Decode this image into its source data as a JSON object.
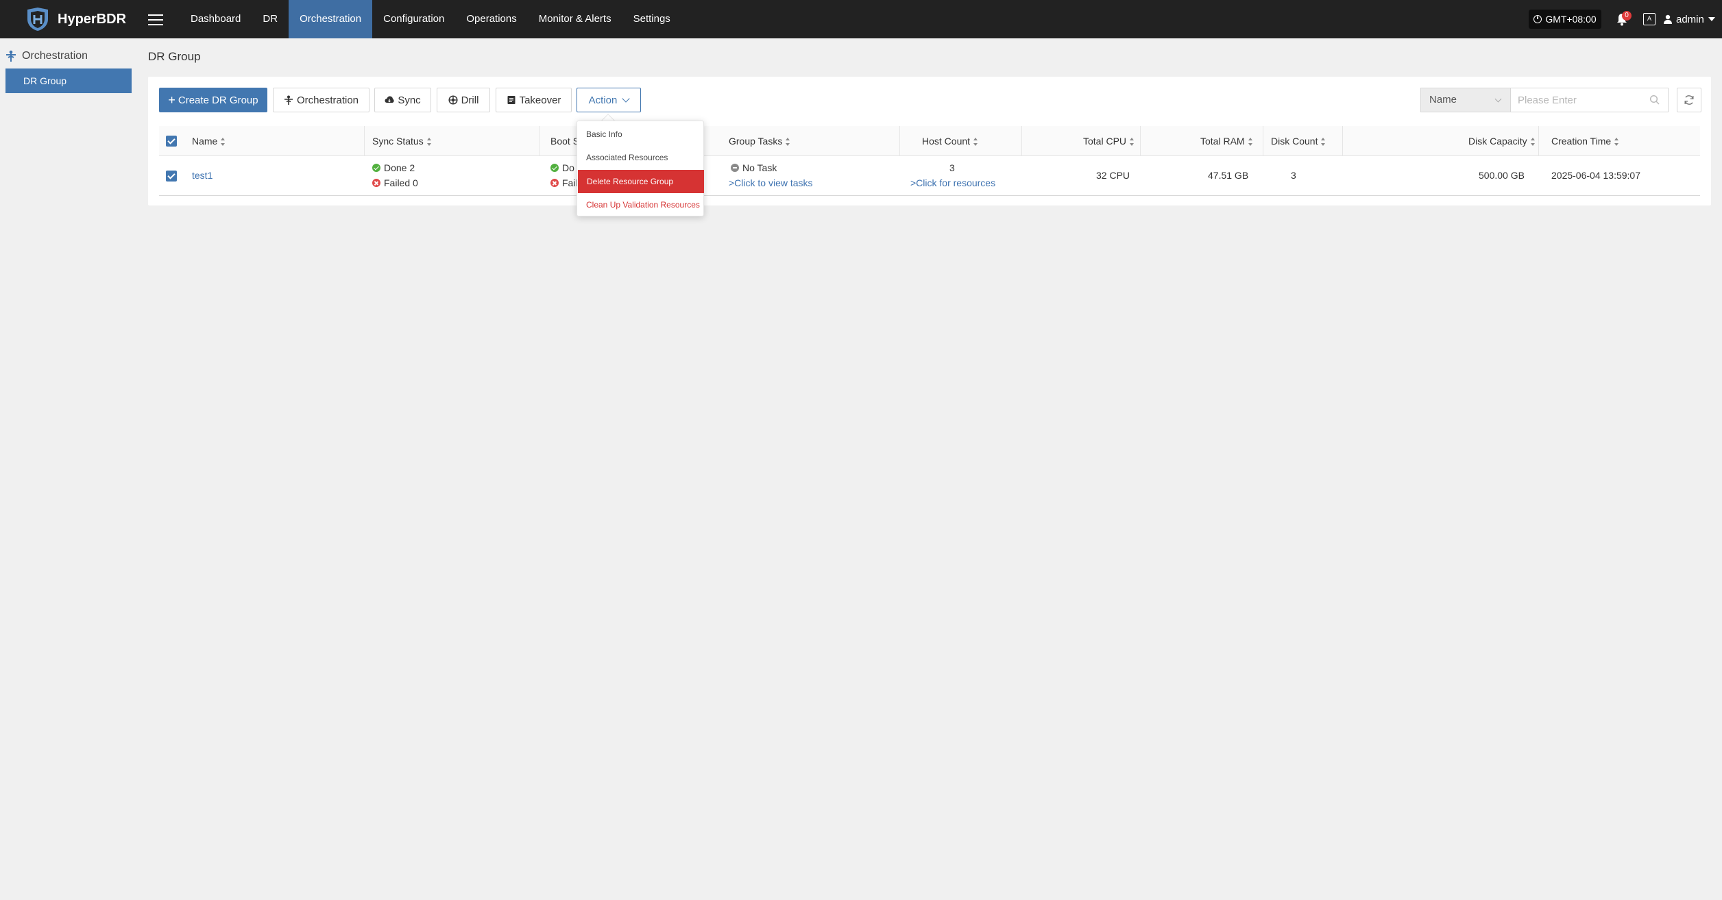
{
  "app": {
    "name": "HyperBDR",
    "timezone": "GMT+08:00",
    "notification_count": "0",
    "lang_badge": "A",
    "user": "admin"
  },
  "nav": {
    "items": [
      {
        "label": "Dashboard"
      },
      {
        "label": "DR"
      },
      {
        "label": "Orchestration",
        "active": true
      },
      {
        "label": "Configuration"
      },
      {
        "label": "Operations"
      },
      {
        "label": "Monitor & Alerts"
      },
      {
        "label": "Settings"
      }
    ]
  },
  "sidebar": {
    "heading": "Orchestration",
    "items": [
      {
        "label": "DR Group",
        "active": true
      }
    ]
  },
  "page": {
    "title": "DR Group"
  },
  "toolbar": {
    "create": "Create DR Group",
    "orchestration": "Orchestration",
    "sync": "Sync",
    "drill": "Drill",
    "takeover": "Takeover",
    "action": "Action"
  },
  "search": {
    "field": "Name",
    "placeholder": "Please Enter"
  },
  "table": {
    "headers": {
      "name": "Name",
      "sync_status": "Sync Status",
      "boot_status": "Boot S",
      "group_tasks": "Group Tasks",
      "host_count": "Host Count",
      "total_cpu": "Total CPU",
      "total_ram": "Total RAM",
      "disk_count": "Disk Count",
      "disk_capacity": "Disk Capacity",
      "creation_time": "Creation Time"
    },
    "rows": [
      {
        "name": "test1",
        "sync_done": "Done 2",
        "sync_failed": "Failed 0",
        "boot_done": "Do",
        "boot_failed": "Fail",
        "task_status": "No Task",
        "task_link": ">Click to view tasks",
        "host_count": "3",
        "host_link": ">Click for resources",
        "total_cpu": "32 CPU",
        "total_ram": "47.51 GB",
        "disk_count": "3",
        "disk_capacity": "500.00 GB",
        "creation_time": "2025-06-04 13:59:07"
      }
    ]
  },
  "action_menu": {
    "items": [
      {
        "label": "Basic Info"
      },
      {
        "label": "Associated Resources"
      },
      {
        "label": "Delete Resource Group"
      },
      {
        "label": "Clean Up Validation Resources"
      }
    ]
  },
  "colors": {
    "topbar": "#222222",
    "accent": "#4277b0",
    "danger": "#d63333",
    "success": "#52b03f"
  }
}
